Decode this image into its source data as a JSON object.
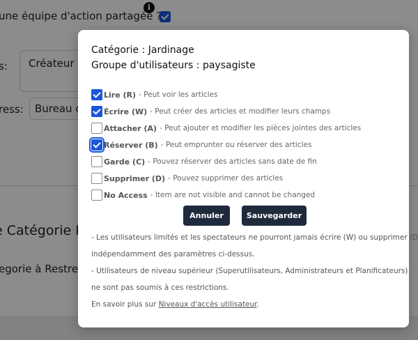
{
  "background": {
    "question": "une équipe d'action partagée ?",
    "info_icon": "i",
    "checkbox_checked": true,
    "label_s": "s:",
    "field1_value": "Créateur de",
    "label_ress": "ress:",
    "field2_value": "Bureau de",
    "section_heading": "e Catégorie Pers",
    "section_sub": "egorie à Restreind"
  },
  "modal": {
    "category": "Catégorie : Jardinage",
    "user_group": "Groupe d'utilisateurs : paysagiste",
    "permissions": [
      {
        "name": "Lire (R)",
        "desc": "- Peut voir les articles",
        "checked": true,
        "focused": false
      },
      {
        "name": "Écrire (W)",
        "desc": "- Peut créer des articles et modifier leurs champs",
        "checked": true,
        "focused": false
      },
      {
        "name": "Attacher (A)",
        "desc": "- Peut ajouter et modifier les pièces jointes des articles",
        "checked": false,
        "focused": false
      },
      {
        "name": "Réserver (B)",
        "desc": "- Peut emprunter ou réserver des articles",
        "checked": true,
        "focused": true
      },
      {
        "name": "Garde (C)",
        "desc": "- Pouvez réserver des articles sans date de fin",
        "checked": false,
        "focused": false
      },
      {
        "name": "Supprimer (D)",
        "desc": "- Pouvez supprimer des articles",
        "checked": false,
        "focused": false
      },
      {
        "name": "No Access",
        "desc": "- Item are not visible and cannot be changed",
        "checked": false,
        "focused": false
      }
    ],
    "cancel_label": "Annuler",
    "save_label": "Sauvegarder",
    "notes": {
      "line1": "- Les utilisateurs limités et les spectateurs ne pourront jamais écrire (W) ou supprimer (D)",
      "line2": "indépendamment des paramètres ci-dessus.",
      "line3": "- Utilisateurs de niveau supérieur (Superutilisateurs, Administrateurs et Planificateurs)",
      "line4": "ne sont pas soumis à ces restrictions.",
      "learn_more_prefix": "En savoir plus sur",
      "learn_more_link": "Niveaux d'accès utilisateur",
      "learn_more_suffix": "."
    }
  }
}
